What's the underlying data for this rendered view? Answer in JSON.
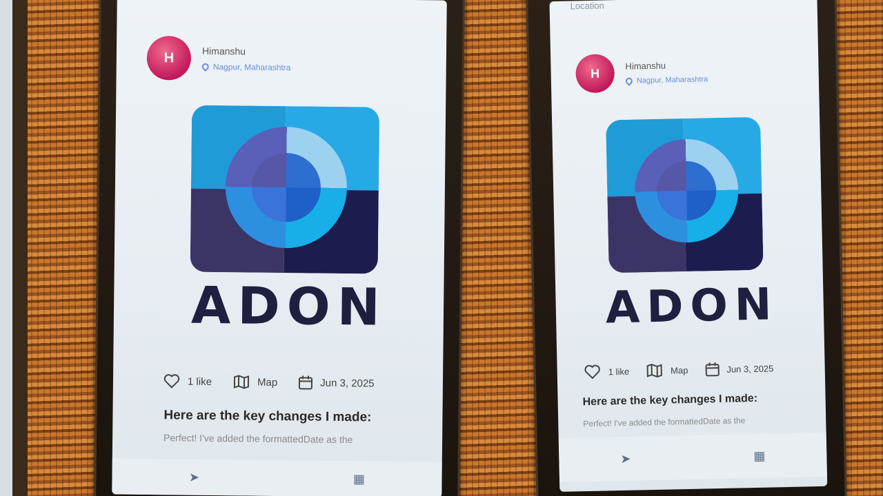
{
  "screens": [
    {
      "location_bar": "",
      "user": {
        "initial": "H",
        "name": "Himanshu",
        "location": "Nagpur, Maharashtra"
      },
      "brand": "ADON",
      "likes": "1 like",
      "map_label": "Map",
      "date": "Jun 3, 2025",
      "title": "Here are the key changes I made:",
      "body": "Perfect! I've added the formattedDate as the"
    },
    {
      "location_bar": "Location",
      "user": {
        "initial": "H",
        "name": "Himanshu",
        "location": "Nagpur, Maharashtra"
      },
      "brand": "ADON",
      "likes": "1 like",
      "map_label": "Map",
      "date": "Jun 3, 2025",
      "title": "Here are the key changes I made:",
      "body": "Perfect! I've added the formattedDate as the"
    }
  ],
  "colors": {
    "accent": "#6b8fd6",
    "avatar": "#c2185b",
    "brand_text": "#1f1f3f"
  },
  "icons": [
    "heart-icon",
    "map-icon",
    "calendar-icon",
    "send-icon",
    "location-pin-icon"
  ]
}
